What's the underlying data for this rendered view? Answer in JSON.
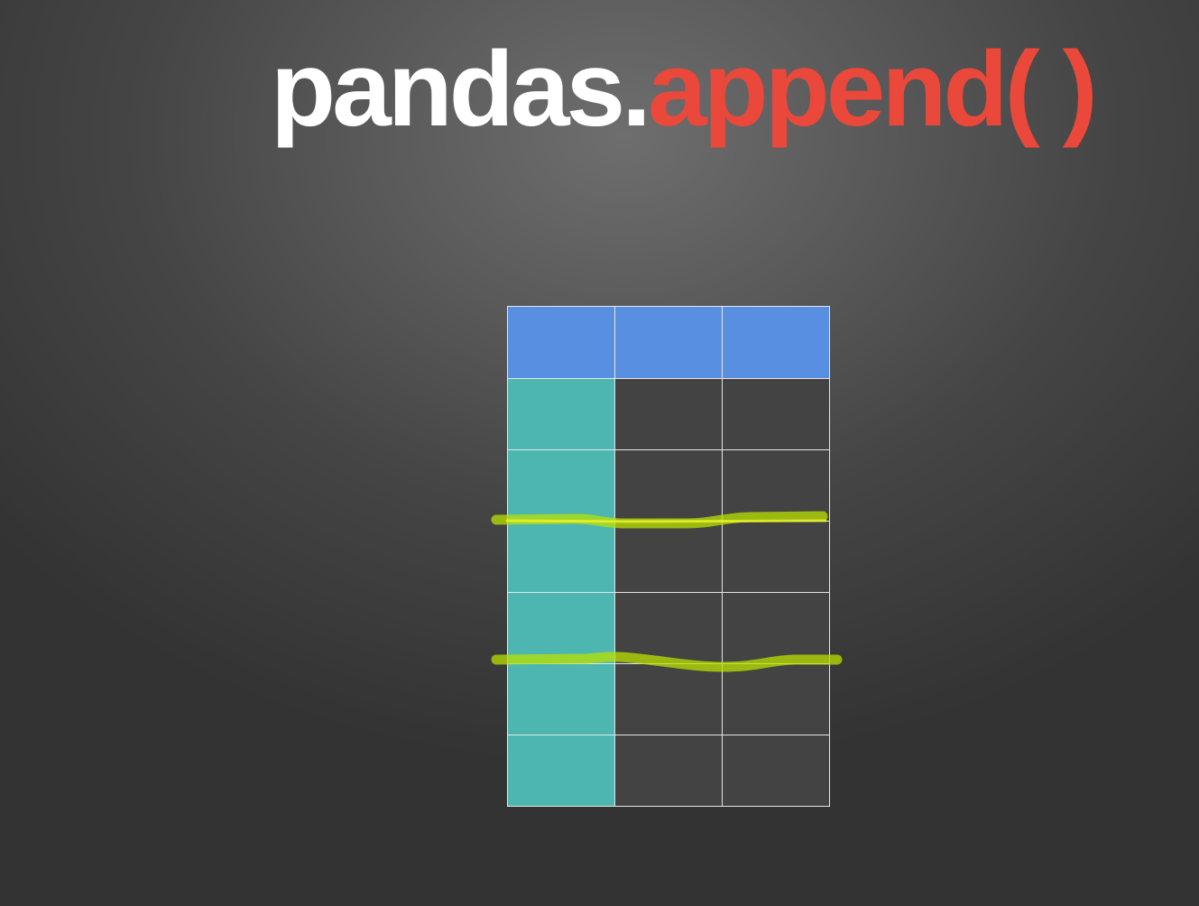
{
  "title": {
    "prefix": "pandas.",
    "method": "append( )"
  },
  "colors": {
    "title_prefix": "#ffffff",
    "title_method": "#e9483a",
    "header_row": "#588fe0",
    "index_column": "#4db6b0",
    "body_cell": "#434343",
    "grid_line": "#e6e6e6",
    "highlight_stroke": "#c8e600"
  },
  "table": {
    "header_rows": 1,
    "data_rows": 6,
    "columns": 3,
    "index_columns": 1
  },
  "highlights": [
    {
      "between_data_rows": [
        2,
        3
      ],
      "description_marker": "append-boundary-1"
    },
    {
      "between_data_rows": [
        4,
        5
      ],
      "description_marker": "append-boundary-2"
    }
  ]
}
